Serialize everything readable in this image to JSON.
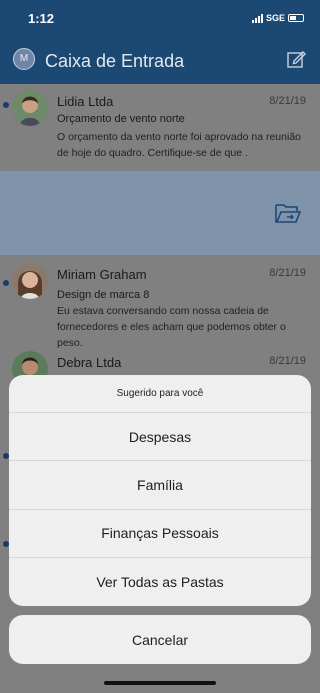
{
  "status": {
    "time": "1:12",
    "carrier": "SGE"
  },
  "header": {
    "title": "Caixa de Entrada",
    "avatar_initial": "M"
  },
  "mails": [
    {
      "sender": "Lidia Ltda",
      "date": "8/21/19",
      "subject": "Orçamento de vento norte",
      "preview": "O orçamento da vento norte foi aprovado na reunião de hoje do quadro. Certifique-se de que ."
    },
    {
      "sender": "Miriam Graham",
      "date": "8/21/19",
      "subject": "Design de marca 8",
      "preview": "Eu estava conversando com nossa cadeia de fornecedores e eles acham que podemos obter o peso."
    },
    {
      "sender": "Debra Ltda",
      "date": "8/21/19"
    }
  ],
  "sheet": {
    "title": "Sugerido para você",
    "options": [
      "Despesas",
      "Família",
      "Finanças Pessoais",
      "Ver Todas as Pastas"
    ],
    "cancel": "Cancelar"
  },
  "icons": {
    "compose": "compose-icon",
    "move_folder": "folder-move-icon"
  }
}
